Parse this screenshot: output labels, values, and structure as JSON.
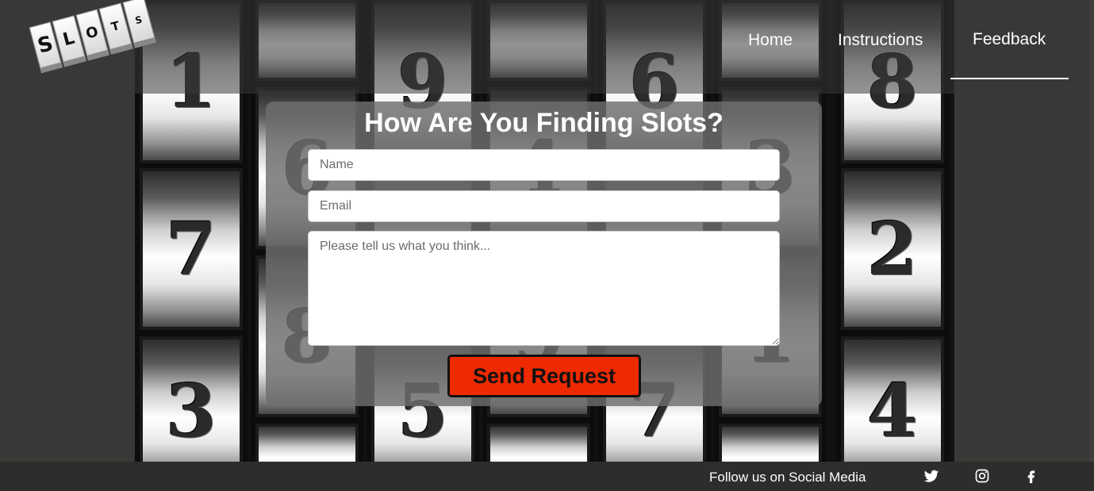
{
  "logo": {
    "letters": [
      "S",
      "L",
      "O",
      "T",
      "S"
    ]
  },
  "nav": {
    "home": "Home",
    "instructions": "Instructions",
    "feedback": "Feedback"
  },
  "reels": [
    {
      "digits": [
        "",
        "1",
        "7",
        "3"
      ]
    },
    {
      "digits": [
        "",
        "6",
        "8",
        ""
      ]
    },
    {
      "digits": [
        "9",
        "",
        "",
        "5"
      ]
    },
    {
      "digits": [
        "",
        "4",
        "9",
        ""
      ]
    },
    {
      "digits": [
        "6",
        "",
        "",
        "7"
      ]
    },
    {
      "digits": [
        "",
        "3",
        "1",
        ""
      ]
    },
    {
      "digits": [
        "8",
        "2",
        "4"
      ]
    }
  ],
  "form": {
    "title": "How Are You Finding Slots?",
    "name_placeholder": "Name",
    "email_placeholder": "Email",
    "message_placeholder": "Please tell us what you think...",
    "submit_label": "Send Request"
  },
  "footer": {
    "follow_text": "Follow us on Social Media",
    "icons": [
      "twitter-icon",
      "instagram-icon",
      "facebook-icon"
    ]
  }
}
